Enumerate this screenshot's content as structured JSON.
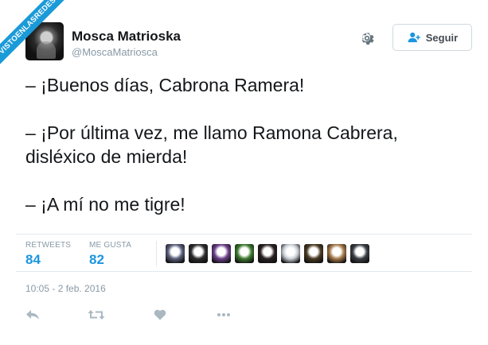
{
  "watermark": {
    "text": "VISTOENLASREDES"
  },
  "author": {
    "name": "Mosca Matrioska",
    "handle": "@MoscaMatriosca"
  },
  "follow_button": {
    "label": "Seguir"
  },
  "tweet": {
    "lines": [
      "– ¡Buenos días, Cabrona Ramera!",
      "– ¡Por última vez, me llamo Ramona Cabrera,",
      "disléxico de mierda!",
      "– ¡A mí no me tigre!"
    ]
  },
  "stats": {
    "retweets_label": "RETWEETS",
    "retweets_count": "84",
    "likes_label": "ME GUSTA",
    "likes_count": "82"
  },
  "liker_avatars": [
    "#5a5f7a",
    "#2b2b2b",
    "#6b3f8a",
    "#3d7a2e",
    "#2a2020",
    "#c9cfd6",
    "#4a3a22",
    "#a67a4a",
    "#3a3f45"
  ],
  "timestamp": "10:05 - 2 feb. 2016",
  "colors": {
    "accent": "#1b95e0",
    "muted": "#8899a6",
    "icon": "#aab8c2",
    "ribbon": "#1b9ad8"
  },
  "icons": [
    "gear-icon",
    "add-user-icon",
    "reply-icon",
    "retweet-icon",
    "like-icon",
    "more-icon"
  ]
}
